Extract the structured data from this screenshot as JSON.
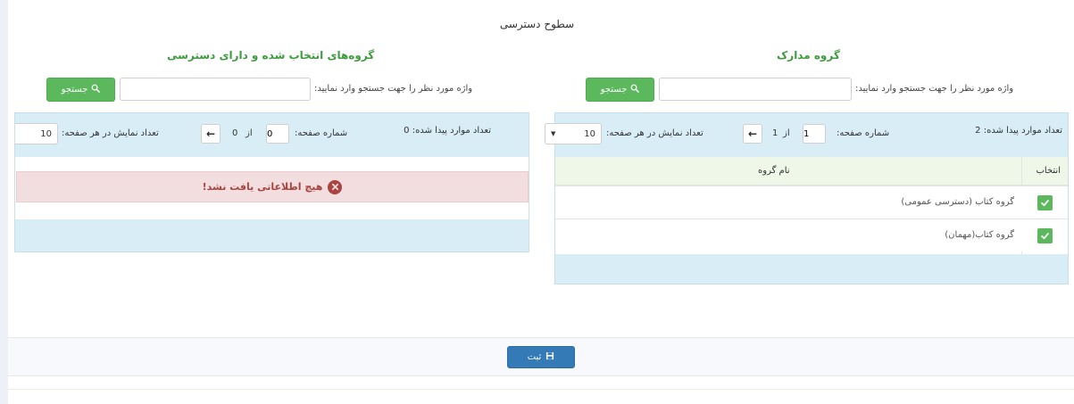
{
  "page": {
    "title": "سطوح دسترسی"
  },
  "right_panel": {
    "title": "گروه مدارک",
    "search_label": "واژه مورد نظر را جهت جستجو وارد نمایید:",
    "search_value": "",
    "search_button": "جستجو",
    "found_text": "تعداد موارد پیدا شده: 2",
    "page_label": "شماره صفحه:",
    "page_number": "1",
    "of_label": "از",
    "total_pages": "1",
    "per_page_label": "تعداد نمایش در هر صفحه:",
    "per_page_value": "10",
    "table": {
      "headers": [
        "انتخاب",
        "نام گروه"
      ],
      "rows": [
        {
          "checked": true,
          "name": "گروه کتاب  (دسترسی عمومی)"
        },
        {
          "checked": true,
          "name": "گروه کتاب(مهمان)"
        }
      ]
    }
  },
  "left_panel": {
    "title": "گروه‌های انتخاب شده و دارای دسترسی",
    "search_label": "واژه مورد نظر را جهت جستجو وارد نمایید:",
    "search_value": "",
    "search_button": "جستجو",
    "found_text": "تعداد موارد پیدا شده: 0",
    "page_label": "شماره صفحه:",
    "page_number": "0",
    "of_label": "از",
    "total_pages": "0",
    "per_page_label": "تعداد نمایش در هر صفحه:",
    "per_page_value": "10",
    "empty_message": "هیچ اطلاعاتی یافت نشد!"
  },
  "footer": {
    "submit_label": "ثبت"
  },
  "icons": {
    "search": "search-icon",
    "arrow": "arrow-left-icon",
    "check": "check-icon",
    "error": "error-circle-icon",
    "save": "floppy-disk-icon",
    "caret": "caret-down-icon"
  },
  "colors": {
    "green": "#5cb85c",
    "title_green": "#3f9b3f",
    "panel_blue": "#d9edf7",
    "danger_bg": "#f2dede",
    "danger_text": "#a94442",
    "primary": "#337ab7"
  }
}
